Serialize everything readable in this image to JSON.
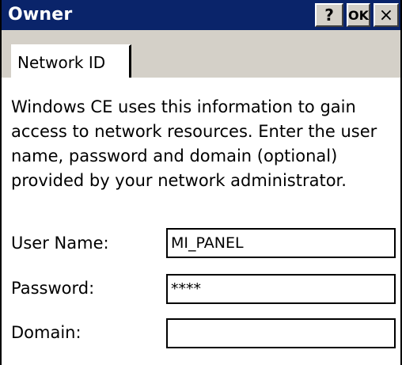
{
  "window": {
    "title": "Owner",
    "buttons": {
      "help": "?",
      "ok": "OK",
      "close": "×"
    }
  },
  "tabs": [
    {
      "label": "Network ID",
      "selected": true
    }
  ],
  "description": "Windows CE uses this information to gain access to network resources. Enter the user name, password and domain (optional) provided by your network administrator.",
  "form": {
    "username": {
      "label": "User Name:",
      "value": "MI_PANEL"
    },
    "password": {
      "label": "Password:",
      "value": "****"
    },
    "domain": {
      "label": "Domain:",
      "value": ""
    }
  },
  "colors": {
    "titlebar": "#0a246a",
    "face": "#d4d0c8",
    "panel": "#ffffff"
  }
}
